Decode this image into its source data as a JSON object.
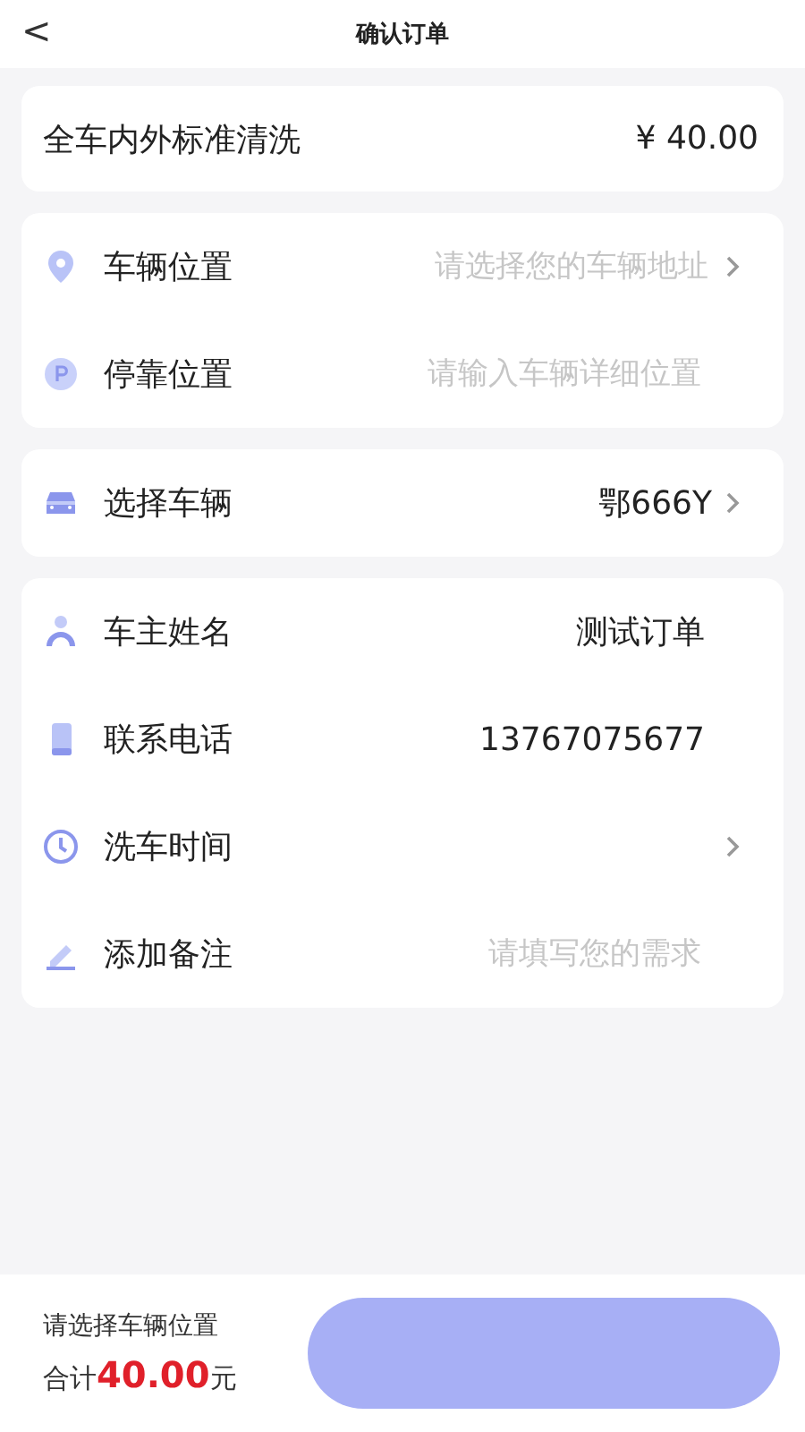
{
  "header": {
    "back": "<",
    "title": "确认订单"
  },
  "service": {
    "name": "全车内外标准清洗",
    "price": "¥ 40.00"
  },
  "groups": [
    {
      "rows": [
        {
          "kind": "location",
          "label": "车辆位置",
          "placeholder": "请选择您的车辆地址",
          "chevron": true
        },
        {
          "kind": "parking",
          "label": "停靠位置",
          "placeholder": "请输入车辆详细位置",
          "chevron": false
        }
      ]
    },
    {
      "rows": [
        {
          "kind": "car",
          "label": "选择车辆",
          "value": "鄂666Y",
          "chevron": true
        }
      ]
    },
    {
      "rows": [
        {
          "kind": "person",
          "label": "车主姓名",
          "value": "测试订单",
          "chevron": false
        },
        {
          "kind": "phone",
          "label": "联系电话",
          "value": "13767075677",
          "chevron": false
        },
        {
          "kind": "clock",
          "label": "洗车时间",
          "chevron": true
        },
        {
          "kind": "edit",
          "label": "添加备注",
          "placeholder": "请填写您的需求",
          "chevron": false
        }
      ]
    }
  ],
  "footer": {
    "hint": "请选择车辆位置",
    "total_label": "合计",
    "total": "40.00",
    "unit": "元"
  }
}
